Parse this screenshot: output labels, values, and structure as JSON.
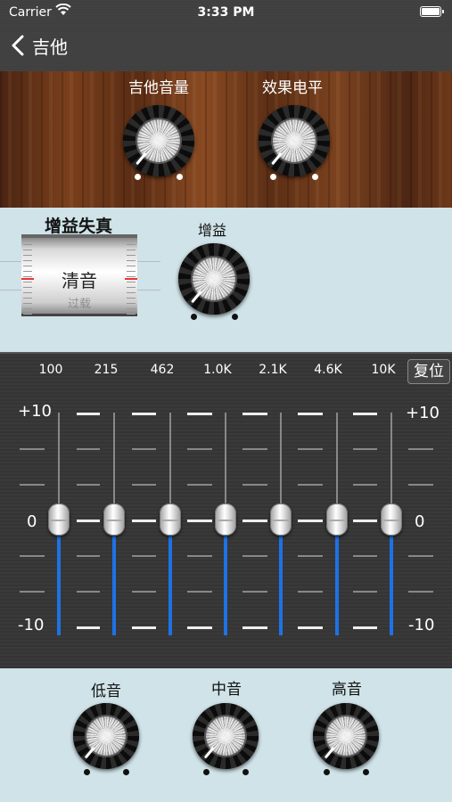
{
  "status_bar": {
    "carrier": "Carrier",
    "time": "3:33 PM"
  },
  "nav": {
    "back_label": "吉他"
  },
  "amp": {
    "volume_label": "吉他音量",
    "effect_label": "效果电平"
  },
  "distortion": {
    "title": "增益失真",
    "selected_mode": "清音",
    "next_mode": "过载",
    "gain_label": "增益"
  },
  "eq": {
    "bands": [
      "100",
      "215",
      "462",
      "1.0K",
      "2.1K",
      "4.6K",
      "10K"
    ],
    "reset_label": "复位",
    "scale_top": "+10",
    "scale_mid": "0",
    "scale_bottom": "-10",
    "band_gain_db": [
      0,
      0,
      0,
      0,
      0,
      0,
      0
    ],
    "accent_color": "#1e72e6"
  },
  "tone": {
    "bass_label": "低音",
    "mid_label": "中音",
    "treble_label": "高音"
  }
}
